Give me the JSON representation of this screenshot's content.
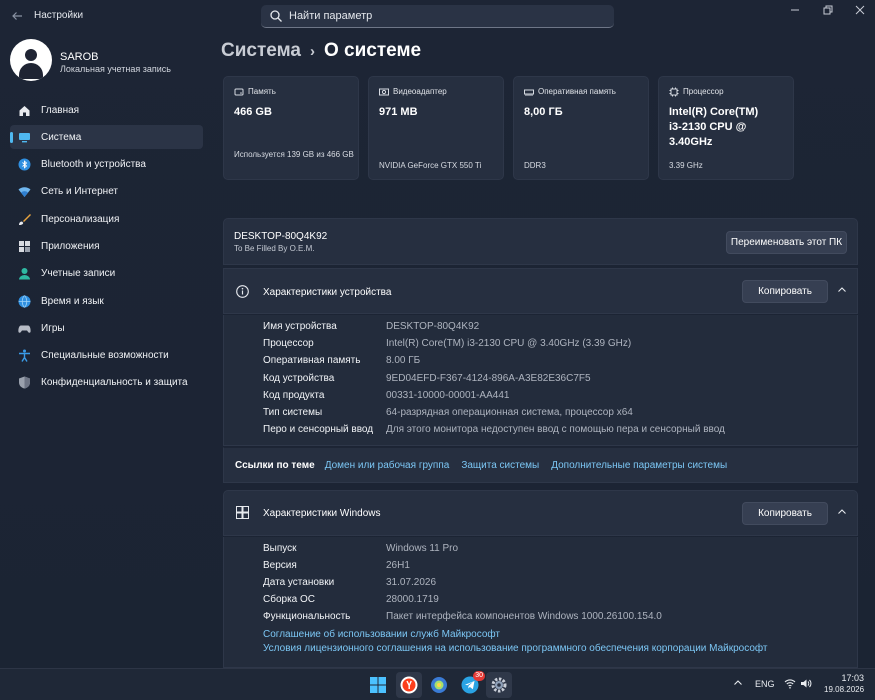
{
  "app": {
    "title": "Настройки"
  },
  "search": {
    "placeholder": "Найти параметр"
  },
  "profile": {
    "name": "SAROB",
    "account_type": "Локальная учетная запись"
  },
  "sidebar": {
    "items": [
      {
        "label": "Главная",
        "icon": "home-icon",
        "active": false
      },
      {
        "label": "Система",
        "icon": "system-icon",
        "active": true
      },
      {
        "label": "Bluetooth и устройства",
        "icon": "bluetooth-icon",
        "active": false
      },
      {
        "label": "Сеть и Интернет",
        "icon": "network-icon",
        "active": false
      },
      {
        "label": "Персонализация",
        "icon": "brush-icon",
        "active": false
      },
      {
        "label": "Приложения",
        "icon": "apps-icon",
        "active": false
      },
      {
        "label": "Учетные записи",
        "icon": "accounts-icon",
        "active": false
      },
      {
        "label": "Время и язык",
        "icon": "globe-icon",
        "active": false
      },
      {
        "label": "Игры",
        "icon": "gamepad-icon",
        "active": false
      },
      {
        "label": "Специальные возможности",
        "icon": "accessibility-icon",
        "active": false
      },
      {
        "label": "Конфиденциальность и защита",
        "icon": "shield-icon",
        "active": false
      }
    ]
  },
  "breadcrumb": {
    "parent": "Система",
    "current": "О системе"
  },
  "cards": [
    {
      "title": "Память",
      "value": "466 GB",
      "sub": "Используется 139 GB из 466 GB",
      "icon": "storage-icon"
    },
    {
      "title": "Видеоадаптер",
      "value": "971 MB",
      "sub": "NVIDIA GeForce GTX 550 Ti",
      "icon": "gpu-icon"
    },
    {
      "title": "Оперативная память",
      "value": "8,00 ГБ",
      "sub": "DDR3",
      "icon": "ram-icon"
    },
    {
      "title": "Процессор",
      "value": "Intel(R) Core(TM) i3-2130 CPU @ 3.40GHz",
      "sub": "3.39 GHz",
      "icon": "cpu-icon"
    }
  ],
  "device_name": {
    "name": "DESKTOP-80Q4K92",
    "model": "To Be Filled By O.E.M.",
    "rename_label": "Переименовать этот ПК"
  },
  "device_specs": {
    "title": "Характеристики устройства",
    "copy_label": "Копировать",
    "rows": [
      {
        "k": "Имя устройства",
        "v": "DESKTOP-80Q4K92"
      },
      {
        "k": "Процессор",
        "v": "Intel(R) Core(TM) i3-2130 CPU @ 3.40GHz (3.39 GHz)"
      },
      {
        "k": "Оперативная память",
        "v": "8.00 ГБ"
      },
      {
        "k": "Код устройства",
        "v": "9ED04EFD-F367-4124-896A-A3E82E36C7F5"
      },
      {
        "k": "Код продукта",
        "v": "00331-10000-00001-AA441"
      },
      {
        "k": "Тип системы",
        "v": "64-разрядная операционная система, процессор x64"
      },
      {
        "k": "Перо и сенсорный ввод",
        "v": "Для этого монитора недоступен ввод с помощью пера и сенсорный ввод"
      }
    ]
  },
  "related_links": {
    "label": "Ссылки по теме",
    "items": [
      "Домен или рабочая группа",
      "Защита системы",
      "Дополнительные параметры системы"
    ]
  },
  "windows_specs": {
    "title": "Характеристики Windows",
    "copy_label": "Копировать",
    "rows": [
      {
        "k": "Выпуск",
        "v": "Windows 11 Pro"
      },
      {
        "k": "Версия",
        "v": "26H1"
      },
      {
        "k": "Дата установки",
        "v": "31.07.2026"
      },
      {
        "k": "Сборка ОС",
        "v": "28000.1719"
      },
      {
        "k": "Функциональность",
        "v": "Пакет интерфейса компонентов Windows 1000.26100.154.0"
      }
    ],
    "links": [
      "Соглашение об использовании служб Майкрософт",
      "Условия лицензионного соглашения на использование программного обеспечения корпорации Майкрософт"
    ]
  },
  "taskbar": {
    "language": "ENG",
    "time": "17:03",
    "date": "19.08.2026",
    "telegram_badge": "30"
  }
}
